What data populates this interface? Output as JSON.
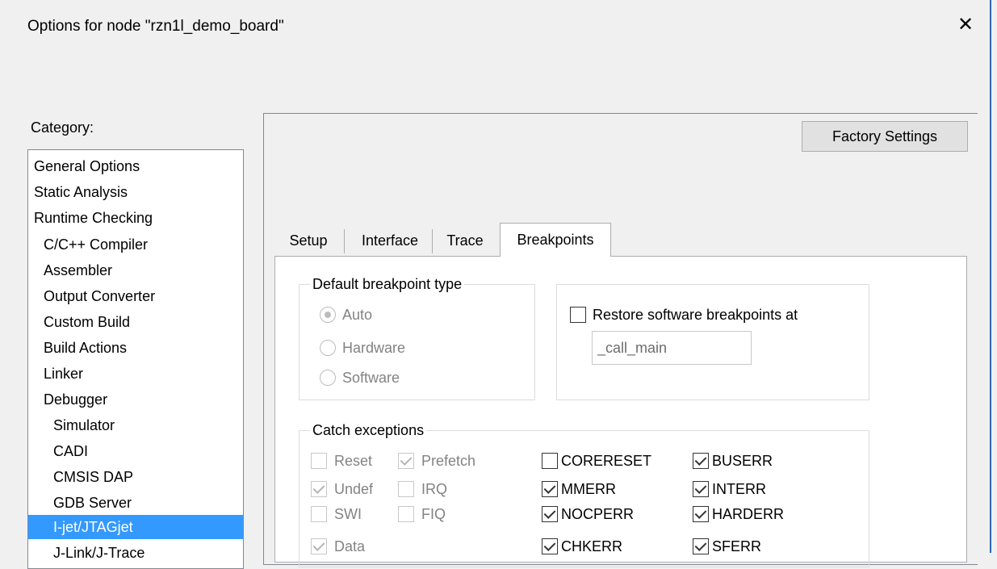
{
  "window": {
    "title": "Options for node \"rzn1l_demo_board\"",
    "close_glyph": "✕"
  },
  "category": {
    "label": "Category:",
    "selected": "I-jet/JTAGjet",
    "items": [
      {
        "label": "General Options"
      },
      {
        "label": "Static Analysis"
      },
      {
        "label": "Runtime Checking"
      },
      {
        "label": "C/C++ Compiler"
      },
      {
        "label": "Assembler"
      },
      {
        "label": "Output Converter"
      },
      {
        "label": "Custom Build"
      },
      {
        "label": "Build Actions"
      },
      {
        "label": "Linker"
      },
      {
        "label": "Debugger"
      },
      {
        "label": "Simulator"
      },
      {
        "label": "CADI"
      },
      {
        "label": "CMSIS DAP"
      },
      {
        "label": "GDB Server"
      },
      {
        "label": "I-jet/JTAGjet"
      },
      {
        "label": "J-Link/J-Trace"
      }
    ]
  },
  "toolbar": {
    "factory_label": "Factory Settings"
  },
  "tabs": [
    {
      "label": "Setup"
    },
    {
      "label": "Interface"
    },
    {
      "label": "Trace"
    },
    {
      "label": "Breakpoints"
    }
  ],
  "active_tab": "Breakpoints",
  "breakpoints": {
    "default_group": {
      "title": "Default breakpoint type",
      "selected": "Auto",
      "enabled": false,
      "options": [
        {
          "label": "Auto"
        },
        {
          "label": "Hardware"
        },
        {
          "label": "Software"
        }
      ]
    },
    "restore": {
      "label": "Restore software breakpoints at",
      "checked": false,
      "value": "_call_main"
    },
    "catch": {
      "title": "Catch exceptions",
      "legacy": [
        {
          "label": "Reset",
          "checked": false,
          "enabled": false
        },
        {
          "label": "Prefetch",
          "checked": true,
          "enabled": false
        },
        {
          "label": "Undef",
          "checked": true,
          "enabled": false
        },
        {
          "label": "IRQ",
          "checked": false,
          "enabled": false
        },
        {
          "label": "SWI",
          "checked": false,
          "enabled": false
        },
        {
          "label": "FIQ",
          "checked": false,
          "enabled": false
        },
        {
          "label": "Data",
          "checked": true,
          "enabled": false
        }
      ],
      "vector": [
        {
          "label": "CORERESET",
          "checked": false
        },
        {
          "label": "BUSERR",
          "checked": true
        },
        {
          "label": "MMERR",
          "checked": true
        },
        {
          "label": "INTERR",
          "checked": true
        },
        {
          "label": "NOCPERR",
          "checked": true
        },
        {
          "label": "HARDERR",
          "checked": true
        },
        {
          "label": "CHKERR",
          "checked": true
        },
        {
          "label": "SFERR",
          "checked": true
        }
      ]
    }
  },
  "colors": {
    "selection": "#3399ff",
    "window_accent": "#2d64b4",
    "disabled_text": "#838383"
  }
}
